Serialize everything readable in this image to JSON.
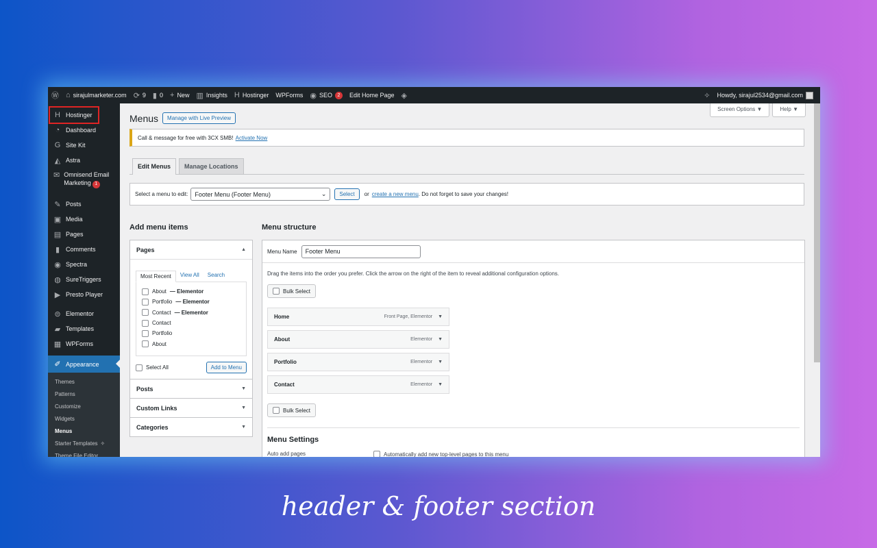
{
  "adminbar": {
    "site": "sirajulmarketer.com",
    "updates": "9",
    "comments": "0",
    "new": "New",
    "insights": "Insights",
    "hostinger": "Hostinger",
    "wpforms": "WPForms",
    "seo": "SEO",
    "seo_badge": "2",
    "edit_home": "Edit Home Page",
    "howdy": "Howdy, sirajul2534@gmail.com"
  },
  "sidebar": {
    "items": [
      {
        "label": "Hostinger"
      },
      {
        "label": "Dashboard"
      },
      {
        "label": "Site Kit"
      },
      {
        "label": "Astra"
      },
      {
        "label": "Omnisend Email Marketing",
        "badge": "1"
      },
      {
        "label": "Posts"
      },
      {
        "label": "Media"
      },
      {
        "label": "Pages"
      },
      {
        "label": "Comments"
      },
      {
        "label": "Spectra"
      },
      {
        "label": "SureTriggers"
      },
      {
        "label": "Presto Player"
      },
      {
        "label": "Elementor"
      },
      {
        "label": "Templates"
      },
      {
        "label": "WPForms"
      },
      {
        "label": "Appearance"
      }
    ],
    "submenu": [
      "Themes",
      "Patterns",
      "Customize",
      "Widgets",
      "Menus",
      "Starter Templates",
      "Theme File Editor"
    ]
  },
  "main": {
    "screen_options": "Screen Options ▼",
    "help": "Help ▼",
    "title": "Menus",
    "live_preview": "Manage with Live Preview",
    "notice_text": "Call & message for free with 3CX SMB!",
    "notice_link": "Activate Now",
    "tabs": [
      "Edit Menus",
      "Manage Locations"
    ],
    "select_label": "Select a menu to edit:",
    "select_value": "Footer Menu (Footer Menu)",
    "select_btn": "Select",
    "or_text": "or",
    "create_link": "create a new menu",
    "save_note": ". Do not forget to save your changes!"
  },
  "add_items": {
    "title": "Add menu items",
    "pages_head": "Pages",
    "mini_tabs": [
      "Most Recent",
      "View All",
      "Search"
    ],
    "pages": [
      {
        "name": "About",
        "suffix": " — Elementor"
      },
      {
        "name": "Portfolio",
        "suffix": " — Elementor"
      },
      {
        "name": "Contact",
        "suffix": " — Elementor"
      },
      {
        "name": "Contact",
        "suffix": ""
      },
      {
        "name": "Portfolio",
        "suffix": ""
      },
      {
        "name": "About",
        "suffix": ""
      }
    ],
    "select_all": "Select All",
    "add_btn": "Add to Menu",
    "others": [
      "Posts",
      "Custom Links",
      "Categories"
    ]
  },
  "structure": {
    "title": "Menu structure",
    "menu_name_label": "Menu Name",
    "menu_name_value": "Footer Menu",
    "instructions": "Drag the items into the order you prefer. Click the arrow on the right of the item to reveal additional configuration options.",
    "bulk": "Bulk Select",
    "items": [
      {
        "title": "Home",
        "meta": "Front Page, Elementor"
      },
      {
        "title": "About",
        "meta": "Elementor"
      },
      {
        "title": "Portfolio",
        "meta": "Elementor"
      },
      {
        "title": "Contact",
        "meta": "Elementor"
      }
    ],
    "settings_title": "Menu Settings",
    "auto_add_label": "Auto add pages",
    "auto_add_option": "Automatically add new top-level pages to this menu"
  },
  "caption": "header & footer section",
  "colors": {
    "accent": "#2271b1",
    "adminbar": "#1d2327",
    "badge": "#d63638",
    "highlight": "#e02424"
  }
}
